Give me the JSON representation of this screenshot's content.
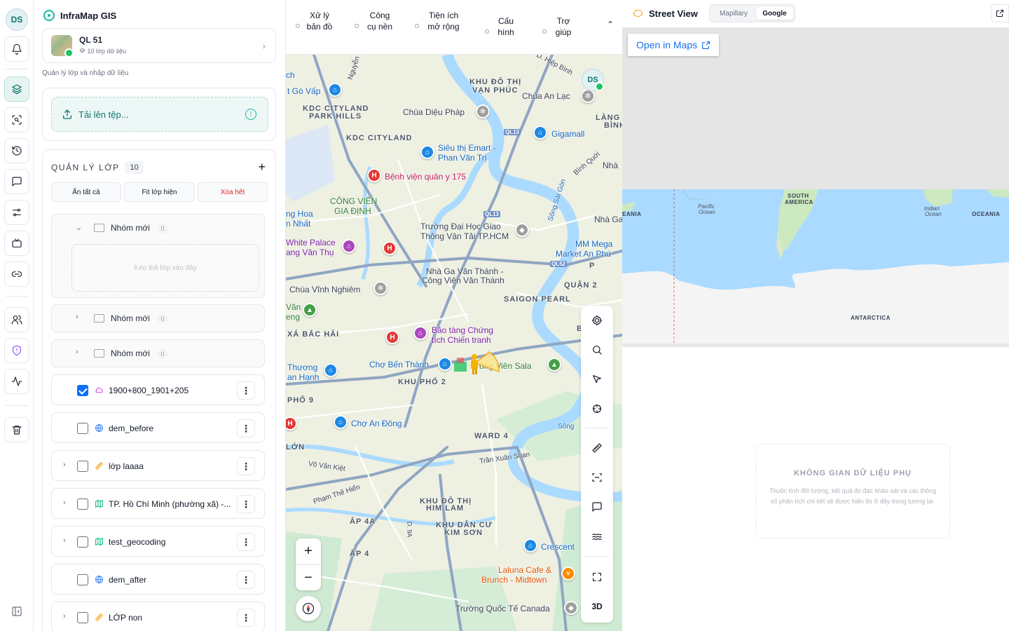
{
  "rail": {
    "avatar_initials": "DS",
    "items": [
      "bell-icon",
      "layers-icon",
      "scan-search-icon",
      "history-icon",
      "message-icon",
      "sliders-icon",
      "tv-icon",
      "link-icon",
      "users-icon",
      "shield-icon",
      "activity-icon",
      "trash-icon",
      "sidebar-collapse-icon"
    ]
  },
  "panel": {
    "app_name": "InfraMap GIS",
    "project": {
      "name": "QL 51",
      "layers_label": "10 lớp dữ liệu"
    },
    "subtitle": "Quản lý lớp và nhập dữ liệu",
    "upload_label": "Tải lên tệp...",
    "layer_manager": {
      "title": "QUẢN LÝ LỚP",
      "count": "10",
      "actions": {
        "hide_all": "Ẩn tất cả",
        "fit": "Fit lớp hiện",
        "clear": "Xóa hết"
      },
      "groups": [
        {
          "name": "Nhóm mới",
          "count": "0",
          "expanded": true,
          "drop_hint": "Kéo thả lớp vào đây"
        },
        {
          "name": "Nhóm mới",
          "count": "0",
          "expanded": false
        },
        {
          "name": "Nhóm mới",
          "count": "0",
          "expanded": false
        }
      ],
      "layers": [
        {
          "name": "1900+800_1901+205",
          "checked": true,
          "icon": "cloud-icon",
          "icon_color": "#d946ef",
          "expandable": false
        },
        {
          "name": "dem_before",
          "checked": false,
          "icon": "globe-icon",
          "icon_color": "#3b82f6",
          "expandable": false
        },
        {
          "name": "lớp laaaa",
          "checked": false,
          "icon": "ruler-icon",
          "icon_color": "#f59e0b",
          "expandable": true
        },
        {
          "name": "TP. Hồ Chí Minh (phường xã) -...",
          "checked": false,
          "icon": "map-icon",
          "icon_color": "#10b981",
          "expandable": true
        },
        {
          "name": "test_geocoding",
          "checked": false,
          "icon": "map-icon",
          "icon_color": "#10b981",
          "expandable": true
        },
        {
          "name": "dem_after",
          "checked": false,
          "icon": "globe-icon",
          "icon_color": "#3b82f6",
          "expandable": false
        },
        {
          "name": "LỚP non",
          "checked": false,
          "icon": "ruler-icon",
          "icon_color": "#f59e0b",
          "expandable": true
        }
      ]
    }
  },
  "map": {
    "tabs": [
      "Xử lý bản đồ",
      "Công cụ nền",
      "Tiện ích mở rộng",
      "Cấu hình",
      "Trợ giúp"
    ],
    "avatar_initials": "DS",
    "labels": [
      {
        "t": "KHU ĐÔ THỊ",
        "c": "b"
      },
      {
        "t": "VẠN PHÚC",
        "c": "b"
      },
      {
        "t": "Chùa An Lạc",
        "c": ""
      },
      {
        "t": "KDC CITYLAND",
        "c": "b"
      },
      {
        "t": "PARK HILLS",
        "c": "b"
      },
      {
        "t": "Chùa Diệu Pháp",
        "c": ""
      },
      {
        "t": "KDC CITYLAND",
        "c": "b"
      },
      {
        "t": "Gigamall",
        "c": "blue"
      },
      {
        "t": "Siêu thị Emart -",
        "c": "blue"
      },
      {
        "t": "Phan Văn Trị",
        "c": "blue"
      },
      {
        "t": "Bệnh viện quân y 175",
        "c": "pink"
      },
      {
        "t": "CÔNG VIÊN",
        "c": "green"
      },
      {
        "t": "GIA ĐỊNH",
        "c": "green"
      },
      {
        "t": "Trường Đại Học Giao",
        "c": ""
      },
      {
        "t": "Thông Vận Tải TP.HCM",
        "c": ""
      },
      {
        "t": "Nhà Ga Văn Thánh -",
        "c": ""
      },
      {
        "t": "Công Viên Văn Thánh",
        "c": ""
      },
      {
        "t": "MM Mega",
        "c": "blue"
      },
      {
        "t": "Market An Phú",
        "c": "blue"
      },
      {
        "t": "QUẬN 2",
        "c": "b"
      },
      {
        "t": "Chùa Vĩnh Nghiêm",
        "c": ""
      },
      {
        "t": "SAIGON PEARL",
        "c": "b"
      },
      {
        "t": "XÁ BẮC HẢI",
        "c": "b"
      },
      {
        "t": "Bảo tàng Chứng",
        "c": "purp"
      },
      {
        "t": "tích Chiến tranh",
        "c": "purp"
      },
      {
        "t": "Chợ Bến Thành",
        "c": "blue"
      },
      {
        "t": "KHU PHỐ 2",
        "c": "b"
      },
      {
        "t": "ông Viên Sala",
        "c": "green"
      },
      {
        "t": "Chợ An Đông",
        "c": "blue"
      },
      {
        "t": "WARD 4",
        "c": "b"
      },
      {
        "t": "Trần Xuân Soạn",
        "c": ""
      },
      {
        "t": "KHU ĐÔ THỊ",
        "c": "b"
      },
      {
        "t": "HIM LAM",
        "c": "b"
      },
      {
        "t": "KHU DÂN CƯ",
        "c": "b"
      },
      {
        "t": "KIM SƠN",
        "c": "b"
      },
      {
        "t": "ẤP 4A",
        "c": "b"
      },
      {
        "t": "ẤP 4",
        "c": "b"
      },
      {
        "t": "Crescent",
        "c": "blue"
      },
      {
        "t": "Laluna Cafe &",
        "c": "org"
      },
      {
        "t": "Brunch - Midtown",
        "c": "org"
      },
      {
        "t": "Trường Quốc Tế Canada",
        "c": ""
      },
      {
        "t": "Thương",
        "c": "blue"
      },
      {
        "t": "an Hạnh",
        "c": "blue"
      },
      {
        "t": "Văn",
        "c": "green"
      },
      {
        "t": "eng",
        "c": "green"
      },
      {
        "t": "ng Hoa",
        "c": "blue"
      },
      {
        "t": "n Nhất",
        "c": "blue"
      },
      {
        "t": "White Palace",
        "c": "purp"
      },
      {
        "t": "ang Văn Thụ",
        "c": "purp"
      },
      {
        "t": "t Gò Vấp",
        "c": "blue"
      },
      {
        "t": "ch",
        "c": "blue"
      },
      {
        "t": "Nhà",
        "c": ""
      },
      {
        "t": "Nhà Ga",
        "c": ""
      },
      {
        "t": "PHỐ 9",
        "c": "b"
      },
      {
        "t": "LỚN",
        "c": "b"
      },
      {
        "t": "Sông",
        "c": "blue"
      },
      {
        "t": "LÀNG",
        "c": "b"
      },
      {
        "t": "BÌNH",
        "c": "b"
      },
      {
        "t": "P",
        "c": "b"
      },
      {
        "t": "B",
        "c": "b"
      }
    ],
    "road_shields": [
      "QL13",
      "QL13",
      "QL52"
    ],
    "street_labels": [
      "Nguyễn Oanh",
      "D. Hiệp Bình",
      "Bình Quới",
      "Sông Sài Gòn",
      "Võ Văn Kiệt",
      "Phạm Thế Hiển",
      "D. 9A",
      "Sông"
    ],
    "tools": [
      "locate-icon",
      "search-icon",
      "pointer-icon",
      "crosshair-icon",
      "ruler-icon",
      "scan-icon",
      "comment-icon",
      "layers-stack-icon",
      "fullscreen-icon"
    ],
    "tool_3d": "3D",
    "zoom_in": "+",
    "zoom_out": "−"
  },
  "street_view": {
    "title": "Street View",
    "providers": [
      "Mapillary",
      "Google"
    ],
    "active_provider": "Google",
    "open_in_maps": "Open in Maps",
    "world_labels": [
      "SOUTH",
      "AMERICA",
      "Pacific",
      "Ocean",
      "Indian",
      "Ocean",
      "OCEANIA",
      "EANIA",
      "ANTARCTICA"
    ],
    "aux_title": "KHÔNG GIAN DỮ LIỆU PHỤ",
    "aux_text": "Thuộc tính đối tượng, kết quả đo đạc khảo sát và các thông số phân tích chi tiết sẽ được hiển thị ở đây trong tương lai."
  },
  "colors": {
    "accent": "#14b8a6",
    "danger": "#dc2626",
    "checkbox": "#0d6efd",
    "water": "#aadaff",
    "land": "#eef0e2"
  }
}
